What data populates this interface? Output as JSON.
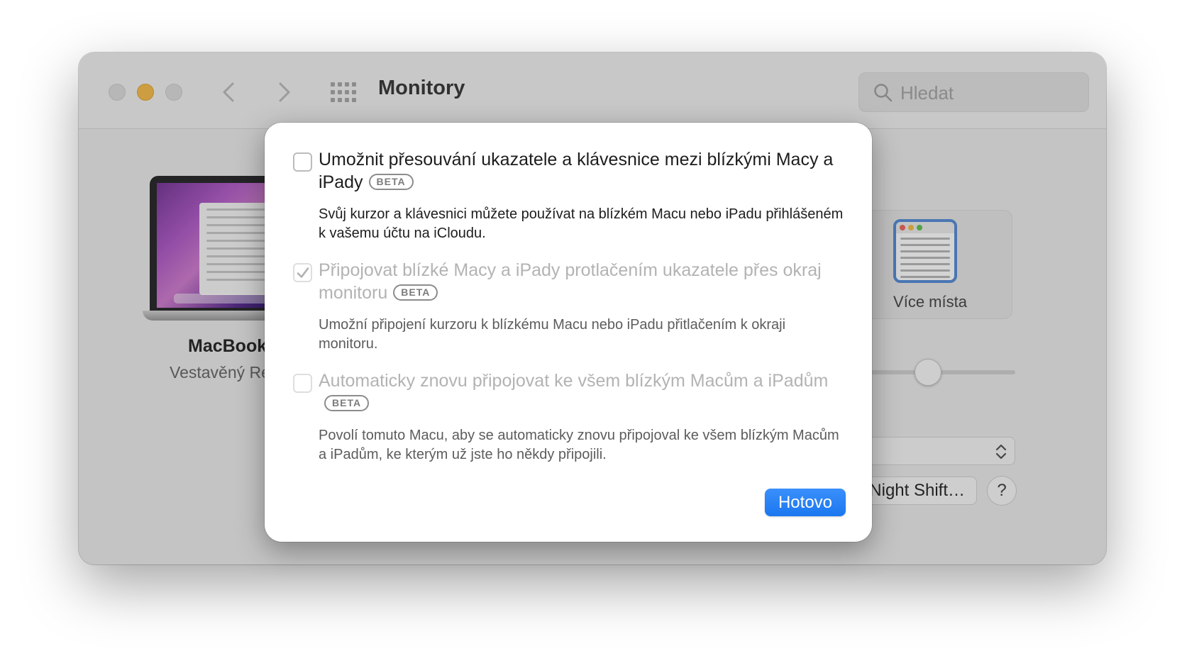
{
  "window": {
    "title": "Monitory",
    "search_placeholder": "Hledat"
  },
  "background": {
    "display_name": "MacBook",
    "display_subtitle": "Vestavěný Re",
    "option_label": "Více místa",
    "night_shift_label": "Night Shift…",
    "help_label": "?"
  },
  "dialog": {
    "options": [
      {
        "title": "Umožnit přesouvání ukazatele a klávesnice mezi blízkými Macy a iPady",
        "badge": "BETA",
        "description": "Svůj kurzor a klávesnici můžete používat na blízkém Macu nebo iPadu přihlášeném k vašemu účtu na iCloudu.",
        "checked": false,
        "enabled": true
      },
      {
        "title": "Připojovat blízké Macy a iPady protlačením ukazatele přes okraj monitoru",
        "badge": "BETA",
        "description": "Umožní připojení kurzoru k blízkému Macu nebo iPadu přitlačením k okraji monitoru.",
        "checked": true,
        "enabled": false
      },
      {
        "title": "Automaticky znovu připojovat ke všem blízkým Macům a iPadům",
        "badge": "BETA",
        "description": "Povolí tomuto Macu, aby se automaticky znovu připojoval ke všem blízkým Macům a iPadům, ke kterým už jste ho někdy připojili.",
        "checked": false,
        "enabled": false
      }
    ],
    "done_label": "Hotovo"
  },
  "colors": {
    "accent": "#1b77f0",
    "minimize": "#f6be4f"
  },
  "icons": [
    "back-icon",
    "forward-icon",
    "grid-icon",
    "search-icon",
    "checkmark-icon",
    "chevron-updown-icon"
  ]
}
